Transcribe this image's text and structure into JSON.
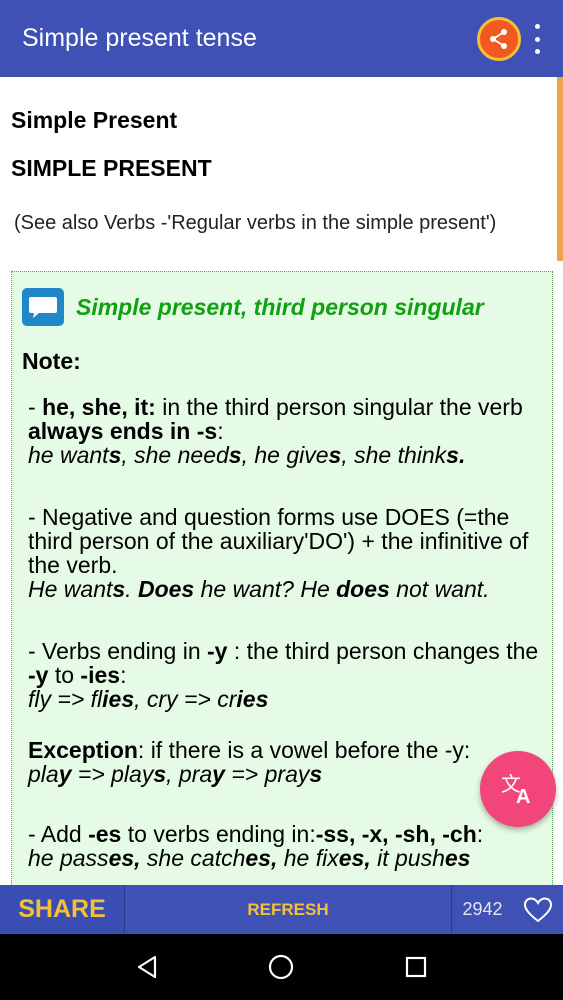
{
  "appbar": {
    "title": "Simple present tense",
    "share_icon": "share-icon",
    "overflow_icon": "more-vertical-icon"
  },
  "content": {
    "subtitle": "Simple Present",
    "heading": "SIMPLE PRESENT",
    "see_also": "(See also Verbs -'Regular verbs in the simple present')",
    "box": {
      "icon": "chat-bubble-icon",
      "title": "Simple present, third person singular",
      "note_label": "Note:",
      "p1": {
        "a": "- ",
        "b": "he, she, it:",
        "c": " in the third person singular the verb ",
        "d": "always ends in -s",
        "e": ":",
        "ex": [
          {
            "t": "he want",
            "b": false
          },
          {
            "t": "s",
            "b": true
          },
          {
            "t": ", she need",
            "b": false
          },
          {
            "t": "s",
            "b": true
          },
          {
            "t": ", he give",
            "b": false
          },
          {
            "t": "s",
            "b": true
          },
          {
            "t": ", she think",
            "b": false
          },
          {
            "t": "s.",
            "b": true
          }
        ]
      },
      "p2": {
        "text": "- Negative and question forms use DOES (=the third person of the auxiliary'DO') + the infinitive of the verb.",
        "ex": [
          {
            "t": "He want",
            "b": false
          },
          {
            "t": "s",
            "b": true
          },
          {
            "t": ". ",
            "b": false
          },
          {
            "t": "Does",
            "b": true
          },
          {
            "t": " he want? He ",
            "b": false
          },
          {
            "t": "does",
            "b": true
          },
          {
            "t": " not want.",
            "b": false
          }
        ]
      },
      "p3": {
        "a": "- Verbs ending in ",
        "b": "-y",
        "c": " : the third person changes the ",
        "d": "-y",
        "e": " to ",
        "f": "-ies",
        "g": ":",
        "ex": [
          {
            "t": "fly => fl",
            "b": false
          },
          {
            "t": "ies",
            "b": true
          },
          {
            "t": ", cry => cr",
            "b": false
          },
          {
            "t": "ies",
            "b": true
          }
        ]
      },
      "p4": {
        "a": "Exception",
        "b": ": if there is a vowel before the -y:",
        "ex": [
          {
            "t": "pla",
            "b": false
          },
          {
            "t": "y",
            "b": true
          },
          {
            "t": " => play",
            "b": false
          },
          {
            "t": "s",
            "b": true
          },
          {
            "t": ", pra",
            "b": false
          },
          {
            "t": "y",
            "b": true
          },
          {
            "t": " => pray",
            "b": false
          },
          {
            "t": "s",
            "b": true
          }
        ]
      },
      "p5": {
        "a": "- Add ",
        "b": "-es",
        "c": " to verbs ending in:",
        "d": "-ss, -x, -sh, -ch",
        "e": ":",
        "ex": [
          {
            "t": "he pass",
            "b": false
          },
          {
            "t": "es,",
            "b": true
          },
          {
            "t": " she catch",
            "b": false
          },
          {
            "t": "es,",
            "b": true
          },
          {
            "t": " he fix",
            "b": false
          },
          {
            "t": "es,",
            "b": true
          },
          {
            "t": " it push",
            "b": false
          },
          {
            "t": "es",
            "b": true
          }
        ]
      }
    }
  },
  "fab": {
    "icon": "translate-icon"
  },
  "bottombar": {
    "share_label": "SHARE",
    "refresh_label": "REFRESH",
    "count": "2942",
    "heart_icon": "heart-icon"
  },
  "navbar": {
    "back_icon": "back-icon",
    "home_icon": "home-icon",
    "recents_icon": "recents-icon"
  },
  "colors": {
    "primary": "#3f51b5",
    "accent_yellow": "#f5c033",
    "box_bg": "#e5fbe5",
    "box_title": "#11a011",
    "fab": "#f2457a",
    "scroll_thumb": "#f5a04a"
  }
}
